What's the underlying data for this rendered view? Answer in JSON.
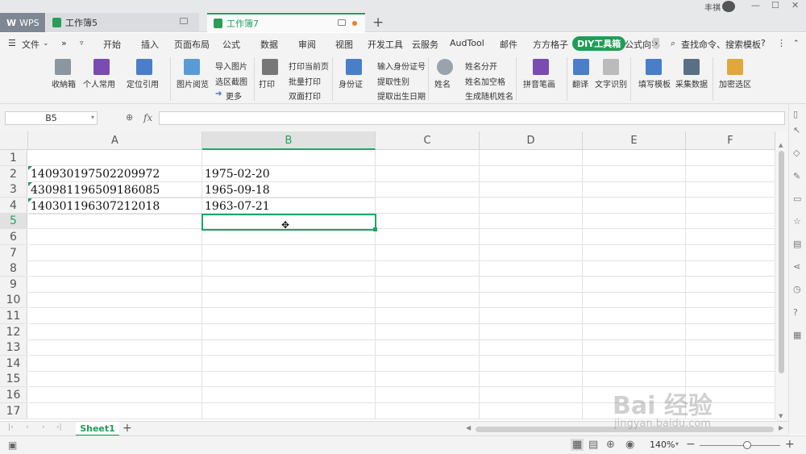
{
  "titlebar": {
    "wps_label": "WPS",
    "tabs": [
      {
        "label": "工作簿5"
      },
      {
        "label": "工作簿7"
      }
    ],
    "user_name": "丰祺"
  },
  "menu": {
    "file": "文件",
    "items": [
      "开始",
      "插入",
      "页面布局",
      "公式",
      "数据",
      "审阅",
      "视图",
      "开发工具",
      "云服务",
      "AudTool",
      "邮件",
      "方方格子",
      "DIY工具箱",
      "公式向导"
    ],
    "search": "查找命令、搜索模板"
  },
  "ribbon": {
    "buttons": {
      "b1": "收納箱",
      "b2": "个人常用",
      "b3": "定位引用",
      "b4": "图片阅览",
      "b5": "导入图片",
      "b6": "选区截图",
      "b7": "更多",
      "b8": "打印",
      "b9": "打印当前页",
      "b10": "批量打印",
      "b11": "双面打印",
      "b12": "身份证",
      "b13": "输入身份证号",
      "b14": "提取性别",
      "b15": "提取出生日期",
      "b16": "姓名",
      "b17": "姓名分开",
      "b18": "姓名加空格",
      "b19": "生成随机姓名",
      "b20": "拼音笔画",
      "b21": "翻译",
      "b22": "文字识别",
      "b23": "填写模板",
      "b24": "采集数据",
      "b25": "加密选区"
    }
  },
  "formula": {
    "name_box": "B5",
    "fx": "fx",
    "content": ""
  },
  "sheet": {
    "columns": [
      "A",
      "B",
      "C",
      "D",
      "E",
      "F"
    ],
    "rows": [
      "1",
      "2",
      "3",
      "4",
      "5",
      "6",
      "7",
      "8",
      "9",
      "10",
      "11",
      "12",
      "13",
      "14",
      "15",
      "16",
      "17"
    ],
    "cells": {
      "a2": "140930197502209972",
      "b2": "1975-02-20",
      "a3": "430981196509186085",
      "b3": "1965-09-18",
      "a4": "140301196307212018",
      "b4": "1963-07-21"
    },
    "active_cell": "B5"
  },
  "sheetbar": {
    "tab": "Sheet1",
    "add": "+"
  },
  "status": {
    "zoom": "140%"
  },
  "watermark": {
    "brand": "Bai 经验",
    "url": "jingyan.baidu.com"
  }
}
